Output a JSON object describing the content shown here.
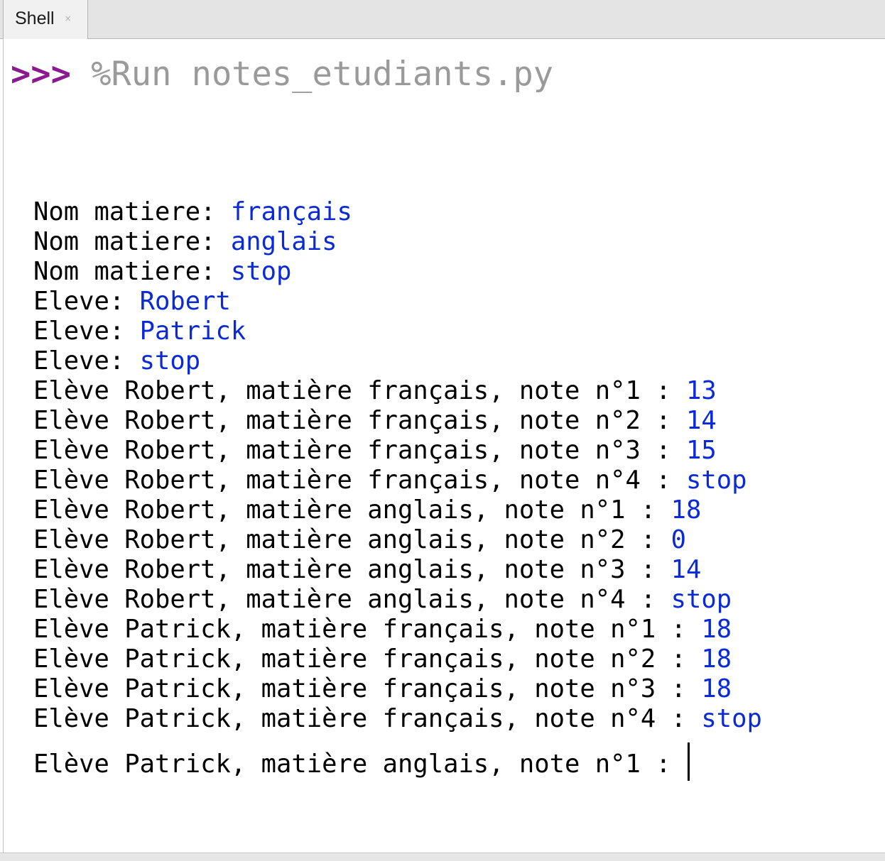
{
  "tabs": [
    {
      "label": "Shell",
      "close_glyph": "×"
    }
  ],
  "prompt": {
    "symbol": ">>>",
    "command": "%Run notes_etudiants.py"
  },
  "output_lines": [
    {
      "prefix": "Nom matiere: ",
      "input": "français"
    },
    {
      "prefix": "Nom matiere: ",
      "input": "anglais"
    },
    {
      "prefix": "Nom matiere: ",
      "input": "stop"
    },
    {
      "prefix": "Eleve: ",
      "input": "Robert"
    },
    {
      "prefix": "Eleve: ",
      "input": "Patrick"
    },
    {
      "prefix": "Eleve: ",
      "input": "stop"
    },
    {
      "prefix": "Elève Robert, matière français, note n°1 : ",
      "input": "13"
    },
    {
      "prefix": "Elève Robert, matière français, note n°2 : ",
      "input": "14"
    },
    {
      "prefix": "Elève Robert, matière français, note n°3 : ",
      "input": "15"
    },
    {
      "prefix": "Elève Robert, matière français, note n°4 : ",
      "input": "stop"
    },
    {
      "prefix": "Elève Robert, matière anglais, note n°1 : ",
      "input": "18"
    },
    {
      "prefix": "Elève Robert, matière anglais, note n°2 : ",
      "input": "0"
    },
    {
      "prefix": "Elève Robert, matière anglais, note n°3 : ",
      "input": "14"
    },
    {
      "prefix": "Elève Robert, matière anglais, note n°4 : ",
      "input": "stop"
    },
    {
      "prefix": "Elève Patrick, matière français, note n°1 : ",
      "input": "18"
    },
    {
      "prefix": "Elève Patrick, matière français, note n°2 : ",
      "input": "18"
    },
    {
      "prefix": "Elève Patrick, matière français, note n°3 : ",
      "input": "18"
    },
    {
      "prefix": "Elève Patrick, matière français, note n°4 : ",
      "input": "stop"
    }
  ],
  "current_input": {
    "prefix": "Elève Patrick, matière anglais, note n°1 : ",
    "input": ""
  },
  "colors": {
    "prompt": "#8b1a8f",
    "command": "#9a9a9a",
    "output_text": "#000000",
    "user_input": "#0a2ad8"
  }
}
